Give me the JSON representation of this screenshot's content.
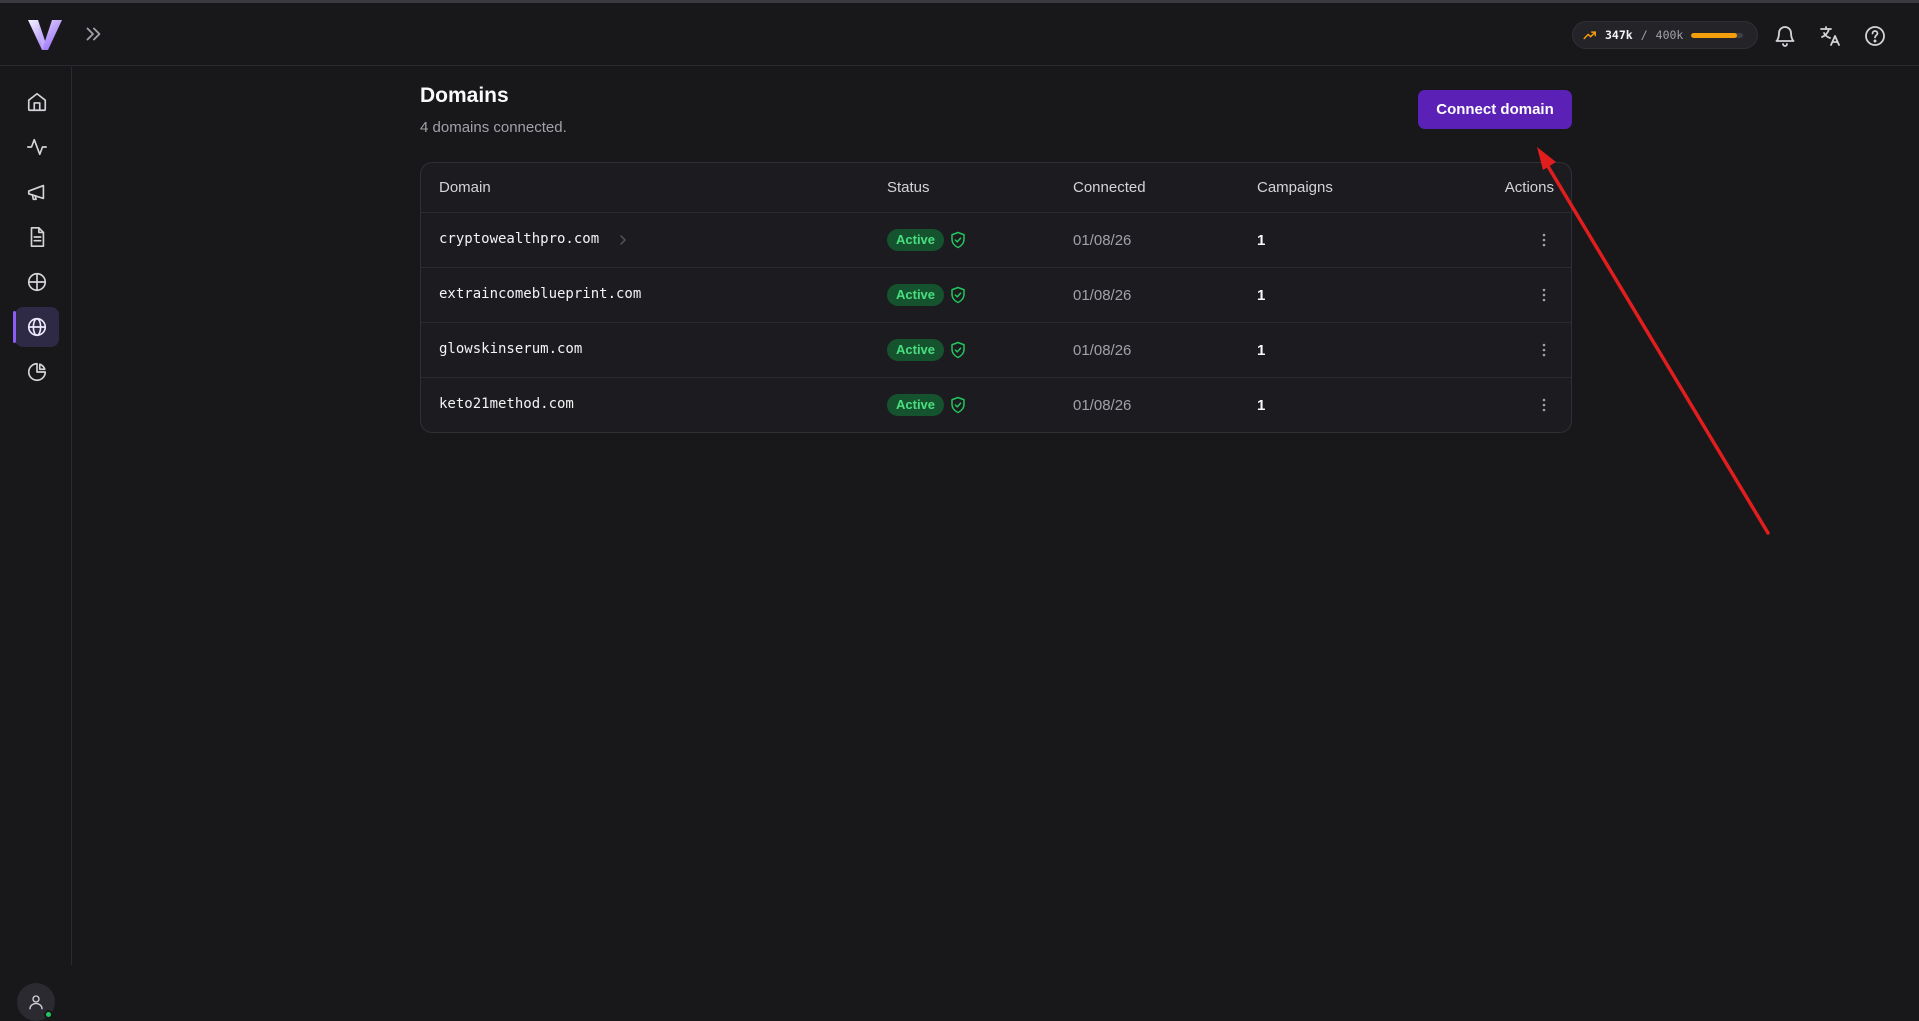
{
  "header": {
    "usage": {
      "used": "347k",
      "separator": "/",
      "limit": "400k",
      "progress_percent": 87
    }
  },
  "sidebar": {
    "items": [
      {
        "icon": "home-icon"
      },
      {
        "icon": "activity-icon"
      },
      {
        "icon": "megaphone-icon"
      },
      {
        "icon": "document-icon"
      },
      {
        "icon": "crosshair-icon"
      },
      {
        "icon": "globe-icon",
        "active": true
      },
      {
        "icon": "pie-chart-icon"
      }
    ]
  },
  "page": {
    "title": "Domains",
    "subtitle": "4 domains connected.",
    "connect_label": "Connect domain"
  },
  "table": {
    "columns": [
      "Domain",
      "Status",
      "Connected",
      "Campaigns",
      "Actions"
    ],
    "rows": [
      {
        "domain": "cryptowealthpro.com",
        "status": "Active",
        "connected": "01/08/26",
        "campaigns": "1"
      },
      {
        "domain": "extraincomeblueprint.com",
        "status": "Active",
        "connected": "01/08/26",
        "campaigns": "1"
      },
      {
        "domain": "glowskinserum.com",
        "status": "Active",
        "connected": "01/08/26",
        "campaigns": "1"
      },
      {
        "domain": "keto21method.com",
        "status": "Active",
        "connected": "01/08/26",
        "campaigns": "1"
      }
    ]
  },
  "colors": {
    "accent": "#5b21b6",
    "active_badge_bg": "#14532d",
    "active_badge_text": "#4ade80",
    "usage_bar": "#f59e0b",
    "annotation_arrow": "#e11d1d"
  }
}
